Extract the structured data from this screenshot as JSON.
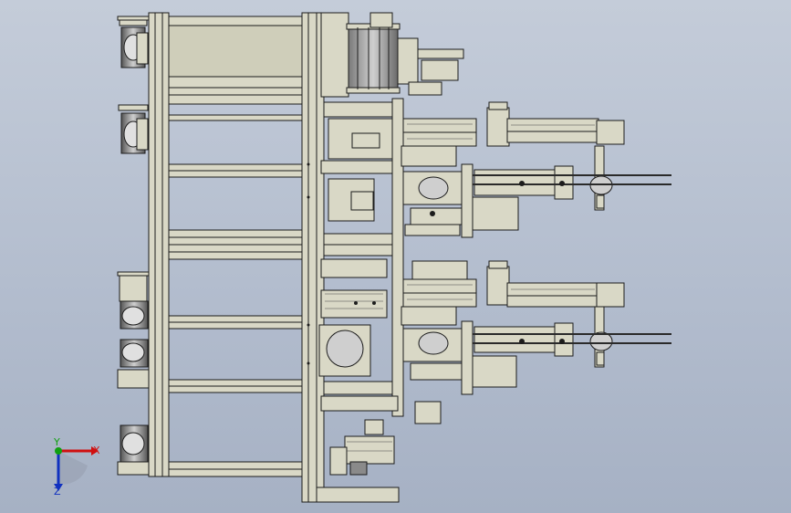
{
  "viewport": {
    "background_top": "#c4ccd9",
    "background_bottom": "#a6b1c4",
    "part_color": "#d9d8c6",
    "edge_color": "#1c1c1c",
    "rail_color": "#2a2a2a"
  },
  "triad": {
    "x_label": "X",
    "y_label": "Y",
    "z_label": "Z",
    "x_color": "#d01010",
    "y_color": "#10a010",
    "z_color": "#1030c0"
  }
}
